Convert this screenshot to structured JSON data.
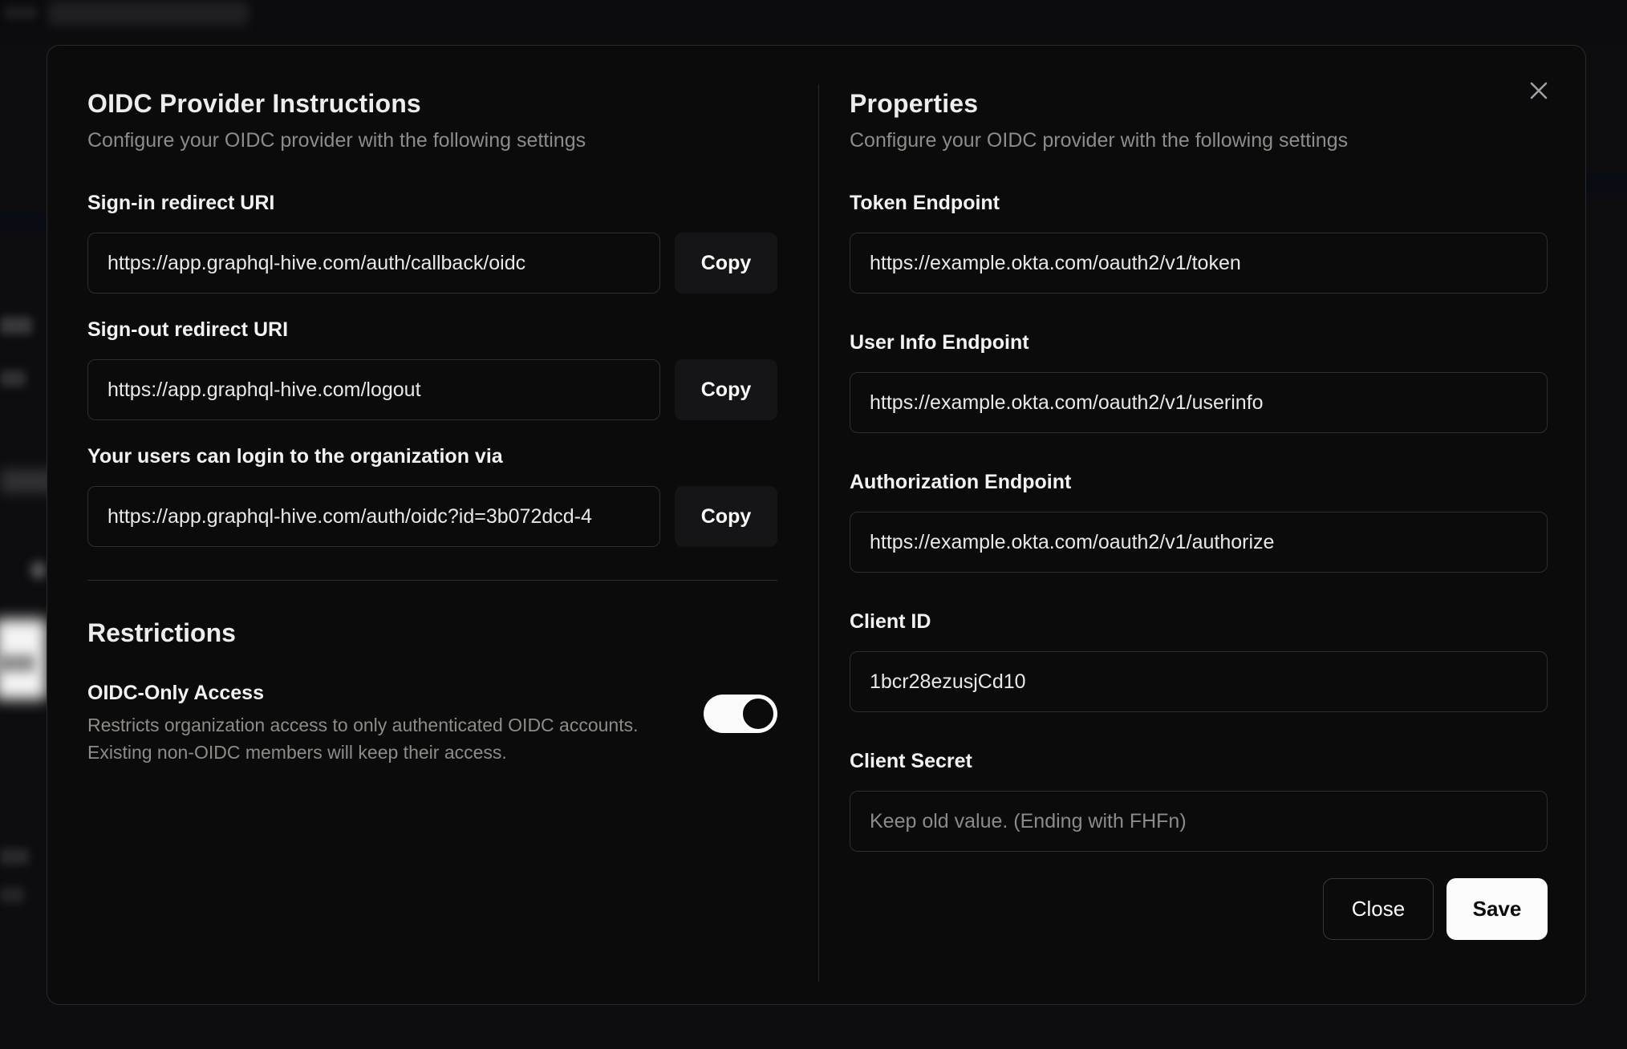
{
  "modal": {
    "close_icon": "×",
    "left": {
      "title": "OIDC Provider Instructions",
      "subtitle": "Configure your OIDC provider with the following settings",
      "fields": [
        {
          "label": "Sign-in redirect URI",
          "value": "https://app.graphql-hive.com/auth/callback/oidc",
          "button": "Copy"
        },
        {
          "label": "Sign-out redirect URI",
          "value": "https://app.graphql-hive.com/logout",
          "button": "Copy"
        },
        {
          "label": "Your users can login to the organization via",
          "value": "https://app.graphql-hive.com/auth/oidc?id=3b072dcd-4",
          "button": "Copy"
        }
      ],
      "restrictions": {
        "title": "Restrictions",
        "toggle_label": "OIDC-Only Access",
        "description_line1": "Restricts organization access to only authenticated OIDC accounts.",
        "description_line2": "Existing non-OIDC members will keep their access.",
        "toggle_state": "on"
      }
    },
    "right": {
      "title": "Properties",
      "subtitle": "Configure your OIDC provider with the following settings",
      "fields": [
        {
          "label": "Token Endpoint",
          "value": "https://example.okta.com/oauth2/v1/token"
        },
        {
          "label": "User Info Endpoint",
          "value": "https://example.okta.com/oauth2/v1/userinfo"
        },
        {
          "label": "Authorization Endpoint",
          "value": "https://example.okta.com/oauth2/v1/authorize"
        },
        {
          "label": "Client ID",
          "value": "1bcr28ezusjCd10"
        },
        {
          "label": "Client Secret",
          "value": "",
          "placeholder": "Keep old value. (Ending with FHFn)"
        }
      ],
      "buttons": {
        "close": "Close",
        "save": "Save"
      }
    }
  },
  "colors": {
    "modal_background": "#0b0b0c",
    "modal_border": "#2a2a2c",
    "input_border": "#2f2f32",
    "text_primary": "#f2f2f3",
    "text_muted": "#8f8c88",
    "button_primary_bg": "#fcfcfc",
    "button_primary_text": "#0b0b0c",
    "toggle_on": "#fafafa"
  }
}
